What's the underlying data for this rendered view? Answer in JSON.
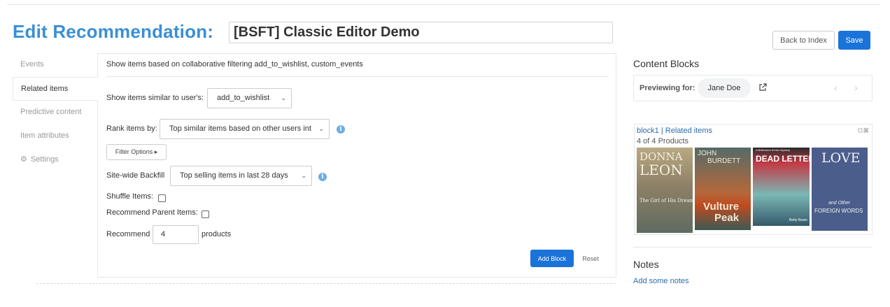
{
  "header": {
    "title": "Edit Recommendation:",
    "name_value": "[BSFT] Classic Editor Demo",
    "back_label": "Back to Index",
    "save_label": "Save"
  },
  "nav": {
    "items": [
      {
        "label": "Events"
      },
      {
        "label": "Related items"
      },
      {
        "label": "Predictive content"
      },
      {
        "label": "Item attributes"
      },
      {
        "label": "Settings",
        "icon": "gear-icon"
      }
    ]
  },
  "panel": {
    "heading": "Show items based on collaborative filtering add_to_wishlist, custom_events",
    "similar_label": "Show items similar to user's:",
    "similar_value": "add_to_wishlist",
    "rank_label": "Rank items by:",
    "rank_value": "Top similar items based on other users int",
    "filter_label": "Filter Options ▸",
    "backfill_label": "Site-wide Backfill",
    "backfill_value": "Top selling items in last 28 days",
    "shuffle_label": "Shuffle Items:",
    "parent_label": "Recommend Parent Items:",
    "recommend_label": "Recommend",
    "recommend_value": "4",
    "products_label": "products",
    "add_block_label": "Add Block",
    "reset_label": "Reset",
    "info_glyph": "i"
  },
  "right": {
    "content_blocks_title": "Content Blocks",
    "previewing_label": "Previewing for:",
    "preview_name": "Jane Doe",
    "block_name": "block1 | Related items",
    "block_count": "4 of 4 Products",
    "books": [
      {
        "author": "DONNA",
        "author2": "LEON",
        "subtitle": "The Girl of His Dreams"
      },
      {
        "author": "JOHN",
        "author2": "BURDETT",
        "title1": "Vulture",
        "title2": "Peak"
      },
      {
        "series": "A Bel­lissima Series Mystery",
        "title": "DEAD LETTER",
        "author": "Betty Beam"
      },
      {
        "title": "LOVE",
        "subtitle": "and Other",
        "title2": "FOREIGN WORDS"
      }
    ],
    "notes_title": "Notes",
    "notes_link": "Add some notes"
  },
  "colors": {
    "accent": "#3a8fd6",
    "primary_button": "#1a73d9",
    "link": "#2e6bb0"
  }
}
